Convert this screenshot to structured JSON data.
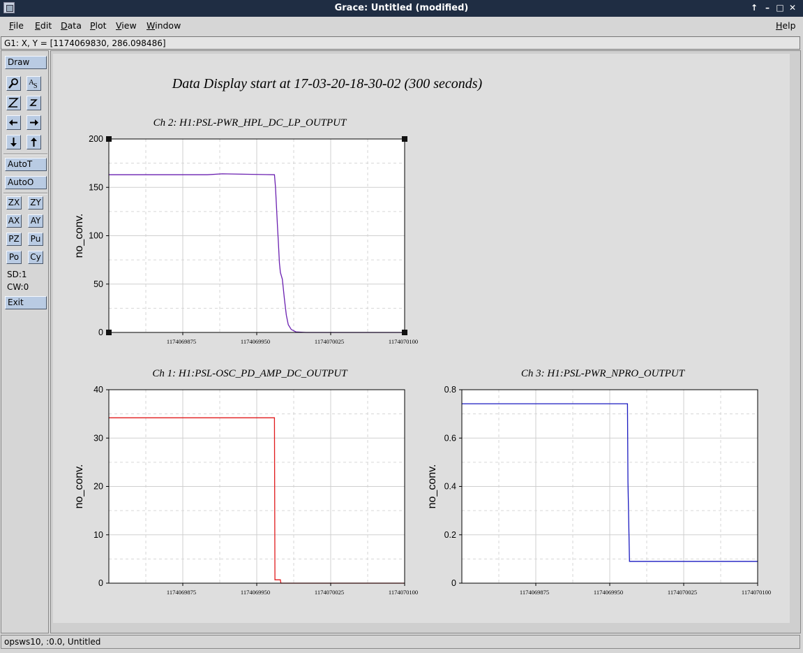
{
  "window": {
    "title": "Grace: Untitled (modified)",
    "buttons": [
      "↑",
      "–",
      "□",
      "✕"
    ]
  },
  "menu": [
    "File",
    "Edit",
    "Data",
    "Plot",
    "View",
    "Window"
  ],
  "menu_help": "Help",
  "locator": "G1: X, Y = [1174069830, 286.098486]",
  "toolbar": {
    "draw": "Draw",
    "zoom_icon": "magnifier-icon",
    "autotick": "AutoT",
    "autoo": "AutoO",
    "buttons": [
      "ZX",
      "ZY",
      "AX",
      "AY",
      "PZ",
      "Pu",
      "Po",
      "Cy"
    ],
    "sd": "SD:1",
    "cw": "CW:0",
    "exit": "Exit"
  },
  "status": "opsws10, :0.0, Untitled",
  "canvas_title": "Data Display start at 17-03-20-18-30-02 (300 seconds)",
  "chart_data": [
    {
      "type": "line",
      "title": "Ch 2: H1:PSL-PWR_HPL_DC_LP_OUTPUT",
      "ylabel": "no_conv.",
      "xlabel": "",
      "xlim": [
        1174069800,
        1174070100
      ],
      "ylim": [
        0,
        200
      ],
      "xticks": [
        1174069875,
        1174069950,
        1174070025,
        1174070100
      ],
      "yticks": [
        0,
        50,
        100,
        150,
        200
      ],
      "grid": true,
      "color": "#6a1fb0",
      "series": [
        {
          "x": [
            1174069800,
            1174069900,
            1174069915,
            1174069968,
            1174069969,
            1174069970,
            1174069971,
            1174069972,
            1174069973,
            1174069974,
            1174069976,
            1174069978,
            1174069980,
            1174069982,
            1174069985,
            1174069990,
            1174070000,
            1174070100
          ],
          "y": [
            163,
            163,
            164,
            163,
            150,
            130,
            110,
            92,
            72,
            62,
            55,
            35,
            18,
            8,
            3,
            0.5,
            0,
            0
          ]
        }
      ]
    },
    {
      "type": "line",
      "title": "Ch 1: H1:PSL-OSC_PD_AMP_DC_OUTPUT",
      "ylabel": "no_conv.",
      "xlabel": "",
      "xlim": [
        1174069800,
        1174070100
      ],
      "ylim": [
        0,
        40
      ],
      "xticks": [
        1174069875,
        1174069950,
        1174070025,
        1174070100
      ],
      "yticks": [
        0,
        10,
        20,
        30,
        40
      ],
      "grid": true,
      "color": "#e0191b",
      "series": [
        {
          "x": [
            1174069800,
            1174069968,
            1174069968.5,
            1174069974,
            1174069974.5,
            1174070100
          ],
          "y": [
            34.2,
            34.2,
            0.7,
            0.7,
            0,
            0
          ]
        }
      ]
    },
    {
      "type": "line",
      "title": "Ch 3: H1:PSL-PWR_NPRO_OUTPUT",
      "ylabel": "no_conv.",
      "xlabel": "",
      "xlim": [
        1174069800,
        1174070100
      ],
      "ylim": [
        0,
        0.8
      ],
      "xticks": [
        1174069875,
        1174069950,
        1174070025,
        1174070100
      ],
      "yticks": [
        0,
        0.2,
        0.4,
        0.6,
        0.8
      ],
      "grid": true,
      "color": "#1a1ac0",
      "series": [
        {
          "x": [
            1174069800,
            1174069968,
            1174069968.5,
            1174069969,
            1174069970,
            1174070100
          ],
          "y": [
            0.742,
            0.742,
            0.42,
            0.3,
            0.09,
            0.09
          ]
        }
      ]
    }
  ]
}
